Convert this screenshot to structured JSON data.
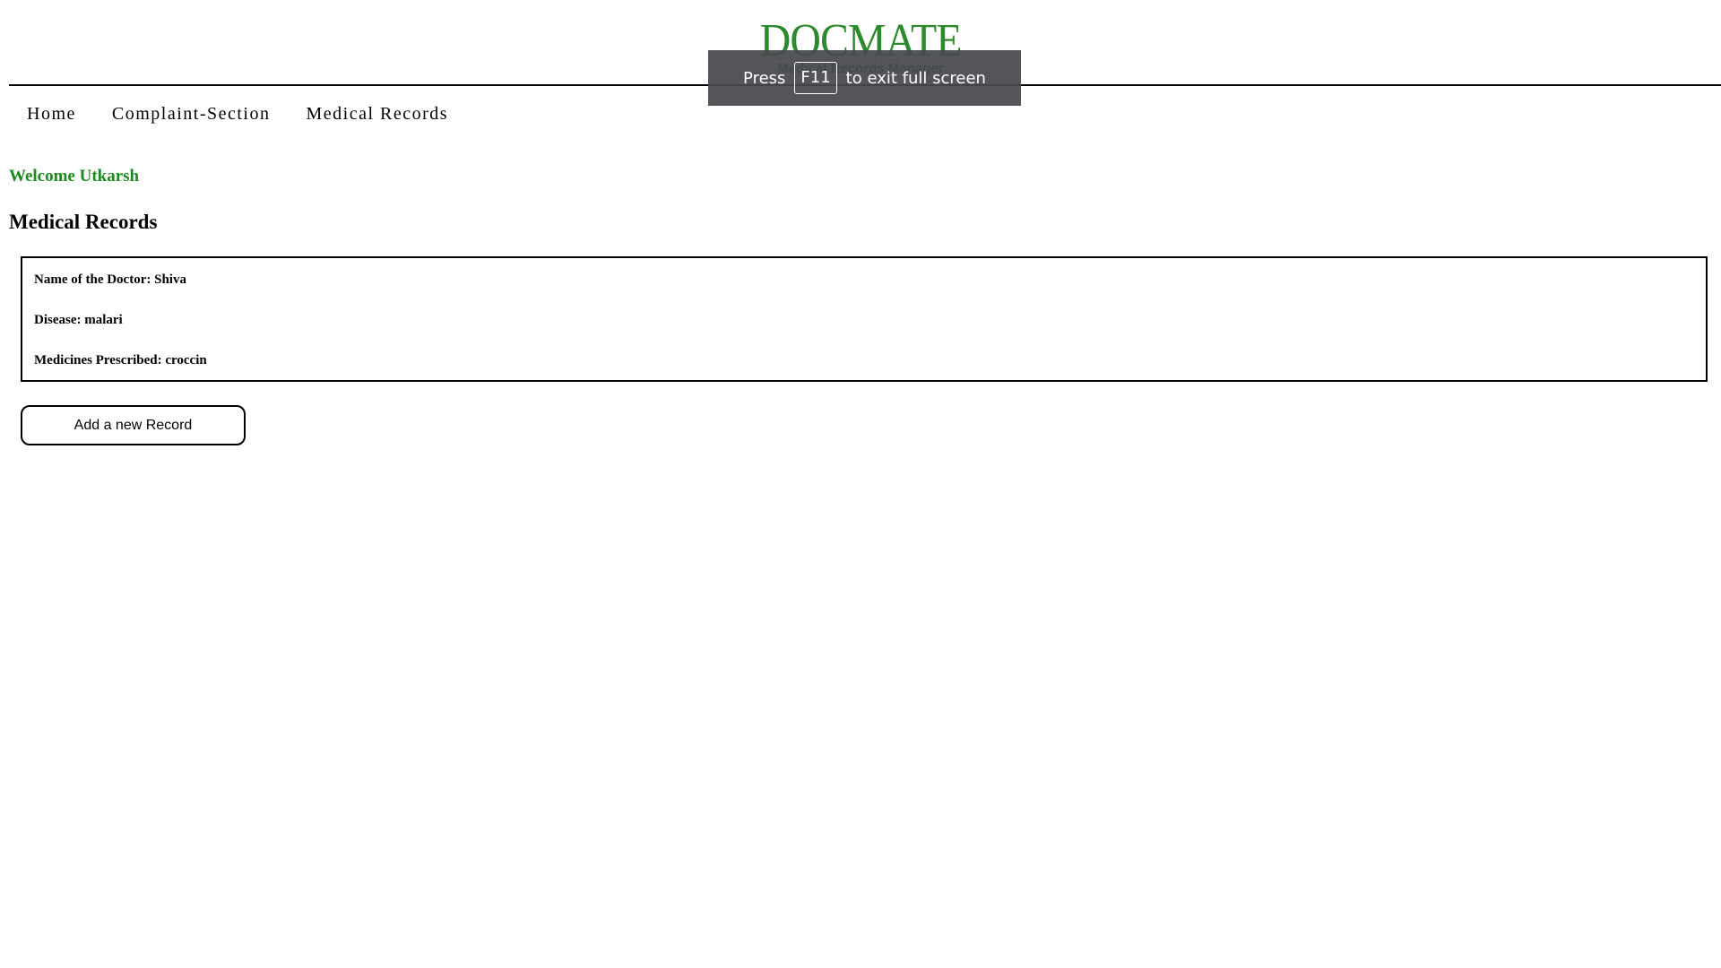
{
  "header": {
    "logo_text": "DOCMATE",
    "tagline": "Medical Records Manager"
  },
  "nav": {
    "items": [
      {
        "label": "Home"
      },
      {
        "label": "Complaint-Section"
      },
      {
        "label": "Medical Records"
      }
    ]
  },
  "welcome": "Welcome Utkarsh",
  "section_title": "Medical Records",
  "records": [
    {
      "doctor": "Name of the Doctor: Shiva",
      "disease": "Disease: malari",
      "medicines": "Medicines Prescribed: croccin"
    }
  ],
  "actions": {
    "add_record_label": "Add a new Record"
  },
  "fullscreen_notice": {
    "prefix": "Press",
    "key": "F11",
    "suffix": "to exit full screen"
  },
  "colors": {
    "brand_green": "#2b8a2b",
    "welcome_green": "#1d8a1d",
    "overlay_bg": "#46484b"
  }
}
